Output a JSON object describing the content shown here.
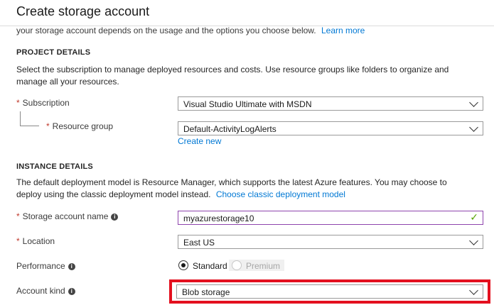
{
  "header": {
    "title": "Create storage account"
  },
  "intro": {
    "text": "your storage account depends on the usage and the options you choose below.",
    "link": "Learn more"
  },
  "project": {
    "heading": "PROJECT DETAILS",
    "description": "Select the subscription to manage deployed resources and costs. Use resource groups like folders to organize and manage all your resources.",
    "subscription": {
      "label": "Subscription",
      "value": "Visual Studio Ultimate with MSDN"
    },
    "resource_group": {
      "label": "Resource group",
      "value": "Default-ActivityLogAlerts",
      "create_link": "Create new"
    }
  },
  "instance": {
    "heading": "INSTANCE DETAILS",
    "description": "The default deployment model is Resource Manager, which supports the latest Azure features. You may choose to deploy using the classic deployment model instead.",
    "classic_link": "Choose classic deployment model",
    "storage_name": {
      "label": "Storage account name",
      "value": "myazurestorage10"
    },
    "location": {
      "label": "Location",
      "value": "East US"
    },
    "performance": {
      "label": "Performance",
      "options": [
        "Standard",
        "Premium"
      ],
      "selected": "Standard"
    },
    "account_kind": {
      "label": "Account kind",
      "value": "Blob storage"
    }
  },
  "symbols": {
    "required": "*",
    "info": "i",
    "check": "✓"
  },
  "colors": {
    "accent": "#0078d4",
    "required": "#c0392b",
    "valid": "#57a300",
    "highlight": "#e3101f"
  }
}
